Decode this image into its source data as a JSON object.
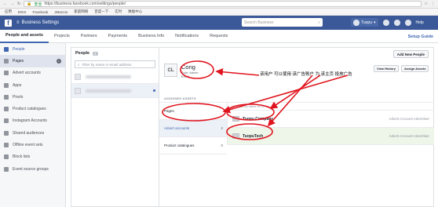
{
  "browser": {
    "secure_label": "安全",
    "url": "https://business.facebook.com/settings/people/",
    "bookmarks": [
      "应用",
      "ENVI",
      "Facebook",
      "JMacros",
      "家庭网络",
      "百度一下",
      "实时",
      "数据中心"
    ]
  },
  "header": {
    "logo": "f",
    "title": "Business Settings",
    "search_placeholder": "Search Business",
    "account_name": "Tuopu",
    "help_label": "Help"
  },
  "tabs": {
    "items": [
      "People and assets",
      "Projects",
      "Partners",
      "Payments",
      "Business Info",
      "Notifications",
      "Requests"
    ],
    "setup_guide": "Setup Guide"
  },
  "sidebar": {
    "items": [
      "People",
      "Pages",
      "Advert accounts",
      "Apps",
      "Pixels",
      "Product catalogues",
      "Instagram Accounts",
      "Shared audiences",
      "Offline event sets",
      "Block lists",
      "Event source groups"
    ]
  },
  "people_panel": {
    "title": "People",
    "count": "2",
    "filter_placeholder": "Filter by name or email address"
  },
  "detail": {
    "add_new_people": "Add New People",
    "initials": "CL",
    "name": "Cong",
    "role_line": "Role: Admin",
    "email_line": "Email:",
    "view_history": "View History",
    "assign_assets": "Assign Assets",
    "annotation": "该用户  可以使用  该广告账户  为  该主页  投放广告",
    "assigned_assets_title": "ASSIGNED ASSETS",
    "categories": [
      {
        "label": "Pages",
        "count": ""
      },
      {
        "label": "Advert accounts",
        "count": "2"
      },
      {
        "label": "Product catalogues",
        "count": "0"
      }
    ],
    "asset_filter_placeholder": "Filter by name or ID",
    "assets": [
      {
        "name": "Tuopu Company",
        "role": "Advert Account Advertiser"
      },
      {
        "name": "TuopuTech",
        "role": "Advert Account Advertiser"
      }
    ]
  },
  "colors": {
    "brand": "#3b5998",
    "annotation_red": "#e0141e"
  }
}
